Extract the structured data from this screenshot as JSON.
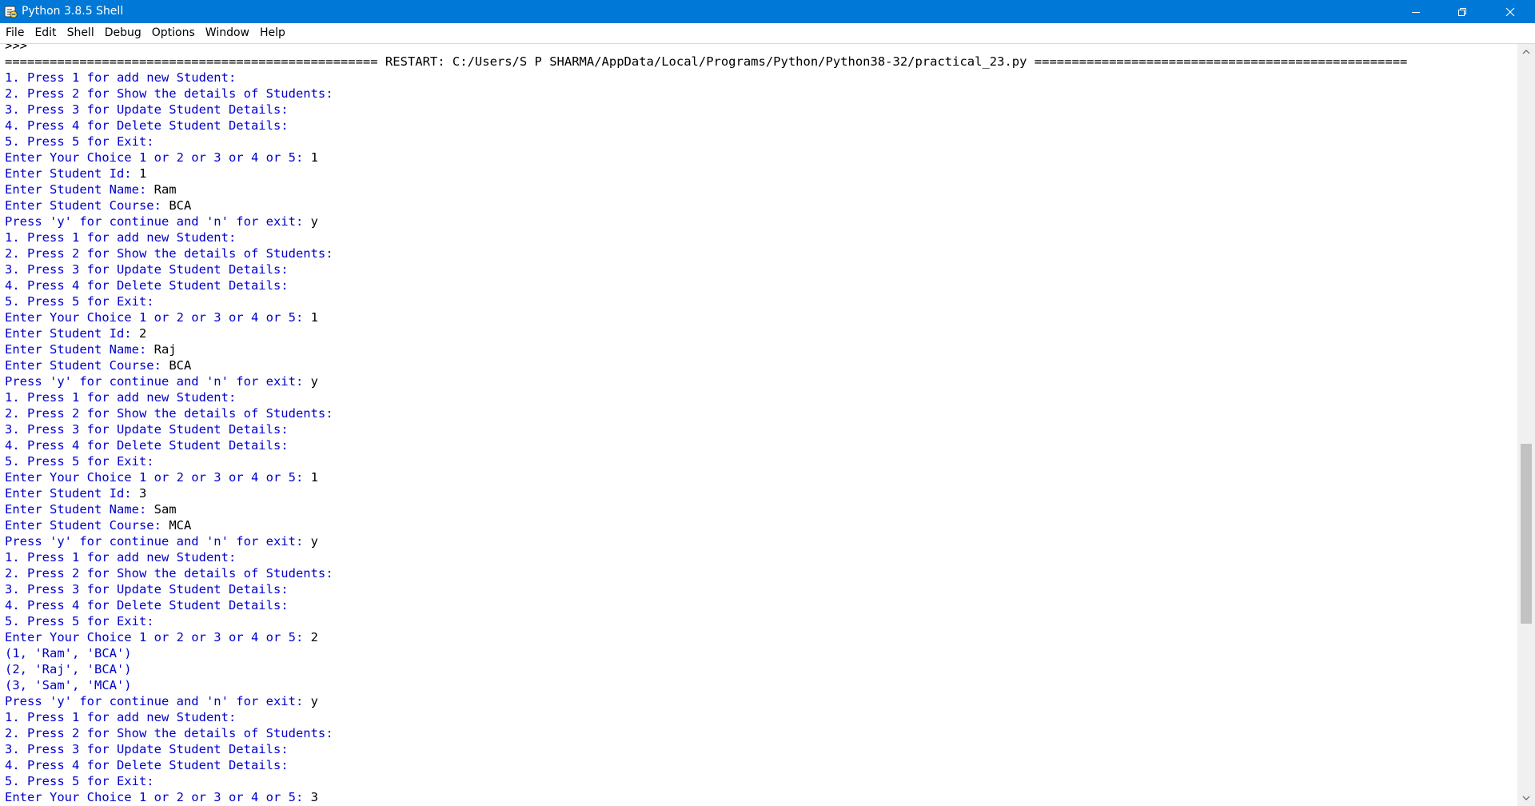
{
  "window": {
    "title": "Python 3.8.5 Shell",
    "icons": {
      "app": "python-idle-icon",
      "minimize": "minimize-icon",
      "maximize": "restore-icon",
      "close": "close-icon"
    }
  },
  "menu": [
    "File",
    "Edit",
    "Shell",
    "Debug",
    "Options",
    "Window",
    "Help"
  ],
  "colors": {
    "titlebar": "#0078d7",
    "output_text": "#0000cc",
    "input_text": "#000000"
  },
  "shell": {
    "lines": [
      {
        "t": "",
        "p": ">>>",
        "v": ""
      },
      {
        "t": "sys",
        "p": "================================================== RESTART: C:/Users/S P SHARMA/AppData/Local/Programs/Python/Python38-32/practical_23.py ==================================================",
        "v": ""
      },
      {
        "t": "out",
        "p": "1. Press 1 for add new Student:",
        "v": ""
      },
      {
        "t": "out",
        "p": "2. Press 2 for Show the details of Students:",
        "v": ""
      },
      {
        "t": "out",
        "p": "3. Press 3 for Update Student Details:",
        "v": ""
      },
      {
        "t": "out",
        "p": "4. Press 4 for Delete Student Details:",
        "v": ""
      },
      {
        "t": "out",
        "p": "5. Press 5 for Exit:",
        "v": ""
      },
      {
        "t": "out",
        "p": "Enter Your Choice 1 or 2 or 3 or 4 or 5: ",
        "v": "1"
      },
      {
        "t": "out",
        "p": "Enter Student Id: ",
        "v": "1"
      },
      {
        "t": "out",
        "p": "Enter Student Name: ",
        "v": "Ram"
      },
      {
        "t": "out",
        "p": "Enter Student Course: ",
        "v": "BCA"
      },
      {
        "t": "out",
        "p": "Press 'y' for continue and 'n' for exit: ",
        "v": "y"
      },
      {
        "t": "out",
        "p": "1. Press 1 for add new Student:",
        "v": ""
      },
      {
        "t": "out",
        "p": "2. Press 2 for Show the details of Students:",
        "v": ""
      },
      {
        "t": "out",
        "p": "3. Press 3 for Update Student Details:",
        "v": ""
      },
      {
        "t": "out",
        "p": "4. Press 4 for Delete Student Details:",
        "v": ""
      },
      {
        "t": "out",
        "p": "5. Press 5 for Exit:",
        "v": ""
      },
      {
        "t": "out",
        "p": "Enter Your Choice 1 or 2 or 3 or 4 or 5: ",
        "v": "1"
      },
      {
        "t": "out",
        "p": "Enter Student Id: ",
        "v": "2"
      },
      {
        "t": "out",
        "p": "Enter Student Name: ",
        "v": "Raj"
      },
      {
        "t": "out",
        "p": "Enter Student Course: ",
        "v": "BCA"
      },
      {
        "t": "out",
        "p": "Press 'y' for continue and 'n' for exit: ",
        "v": "y"
      },
      {
        "t": "out",
        "p": "1. Press 1 for add new Student:",
        "v": ""
      },
      {
        "t": "out",
        "p": "2. Press 2 for Show the details of Students:",
        "v": ""
      },
      {
        "t": "out",
        "p": "3. Press 3 for Update Student Details:",
        "v": ""
      },
      {
        "t": "out",
        "p": "4. Press 4 for Delete Student Details:",
        "v": ""
      },
      {
        "t": "out",
        "p": "5. Press 5 for Exit:",
        "v": ""
      },
      {
        "t": "out",
        "p": "Enter Your Choice 1 or 2 or 3 or 4 or 5: ",
        "v": "1"
      },
      {
        "t": "out",
        "p": "Enter Student Id: ",
        "v": "3"
      },
      {
        "t": "out",
        "p": "Enter Student Name: ",
        "v": "Sam"
      },
      {
        "t": "out",
        "p": "Enter Student Course: ",
        "v": "MCA"
      },
      {
        "t": "out",
        "p": "Press 'y' for continue and 'n' for exit: ",
        "v": "y"
      },
      {
        "t": "out",
        "p": "1. Press 1 for add new Student:",
        "v": ""
      },
      {
        "t": "out",
        "p": "2. Press 2 for Show the details of Students:",
        "v": ""
      },
      {
        "t": "out",
        "p": "3. Press 3 for Update Student Details:",
        "v": ""
      },
      {
        "t": "out",
        "p": "4. Press 4 for Delete Student Details:",
        "v": ""
      },
      {
        "t": "out",
        "p": "5. Press 5 for Exit:",
        "v": ""
      },
      {
        "t": "out",
        "p": "Enter Your Choice 1 or 2 or 3 or 4 or 5: ",
        "v": "2"
      },
      {
        "t": "out",
        "p": "(1, 'Ram', 'BCA')",
        "v": ""
      },
      {
        "t": "out",
        "p": "(2, 'Raj', 'BCA')",
        "v": ""
      },
      {
        "t": "out",
        "p": "(3, 'Sam', 'MCA')",
        "v": ""
      },
      {
        "t": "out",
        "p": "Press 'y' for continue and 'n' for exit: ",
        "v": "y"
      },
      {
        "t": "out",
        "p": "1. Press 1 for add new Student:",
        "v": ""
      },
      {
        "t": "out",
        "p": "2. Press 2 for Show the details of Students:",
        "v": ""
      },
      {
        "t": "out",
        "p": "3. Press 3 for Update Student Details:",
        "v": ""
      },
      {
        "t": "out",
        "p": "4. Press 4 for Delete Student Details:",
        "v": ""
      },
      {
        "t": "out",
        "p": "5. Press 5 for Exit:",
        "v": ""
      },
      {
        "t": "out",
        "p": "Enter Your Choice 1 or 2 or 3 or 4 or 5: ",
        "v": "3"
      }
    ]
  },
  "scrollbar": {
    "up_icon": "scroll-up-arrow-icon",
    "down_icon": "scroll-down-arrow-icon"
  }
}
